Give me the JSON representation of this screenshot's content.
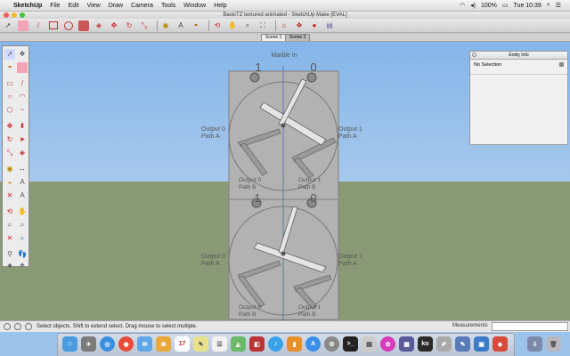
{
  "menubar": {
    "apple": "",
    "app_name": "SketchUp",
    "items": [
      "File",
      "Edit",
      "View",
      "Draw",
      "Camera",
      "Tools",
      "Window",
      "Help"
    ],
    "battery": "100%",
    "clock": "Tue 10:39"
  },
  "window": {
    "title": "BasicTZ textured animated - SketchUp Make [EVAL]"
  },
  "toolbar": {
    "icons": [
      "select-icon",
      "eraser-icon",
      "pencil-icon",
      "rectangle-icon",
      "circle-icon",
      "pushpull-icon",
      "offset-icon",
      "move-icon",
      "rotate-icon",
      "scale-icon",
      "tape-measure-icon",
      "text-icon",
      "paint-bucket-icon",
      "orbit-icon",
      "pan-icon",
      "zoom-icon",
      "zoom-extents-icon",
      "warehouse-icon",
      "components-icon",
      "extension-icon",
      "layout-icon"
    ]
  },
  "scenes": {
    "tab1": "Scene 1",
    "tab2": "Scene 2"
  },
  "entity_info": {
    "title": "Entity Info",
    "selection": "No Selection"
  },
  "model": {
    "top_label": "Marble In",
    "upper": {
      "left_digit": "1",
      "right_digit": "0",
      "out0": "Output 0",
      "path_a_left": "Path A",
      "out1": "Output 1",
      "path_a_right": "Path A",
      "out0_b": "Output 0",
      "path_b_left": "Path B",
      "out1_b": "Output 1",
      "path_b_right": "Path B"
    },
    "lower": {
      "left_digit": "1",
      "right_digit": "0",
      "out0": "Output 0",
      "path_a_left": "Path A",
      "out1": "Output 1",
      "path_a_right": "Path A",
      "out0_b": "Output 0",
      "path_b_left": "Path B",
      "out1_b": "Output 1",
      "path_b_right": "Path B"
    }
  },
  "status": {
    "message": "Select objects. Shift to extend select. Drag mouse to select multiple.",
    "measurements_label": "Measurements"
  },
  "dock": {
    "calendar_day": "17",
    "ko_label": "ko"
  }
}
